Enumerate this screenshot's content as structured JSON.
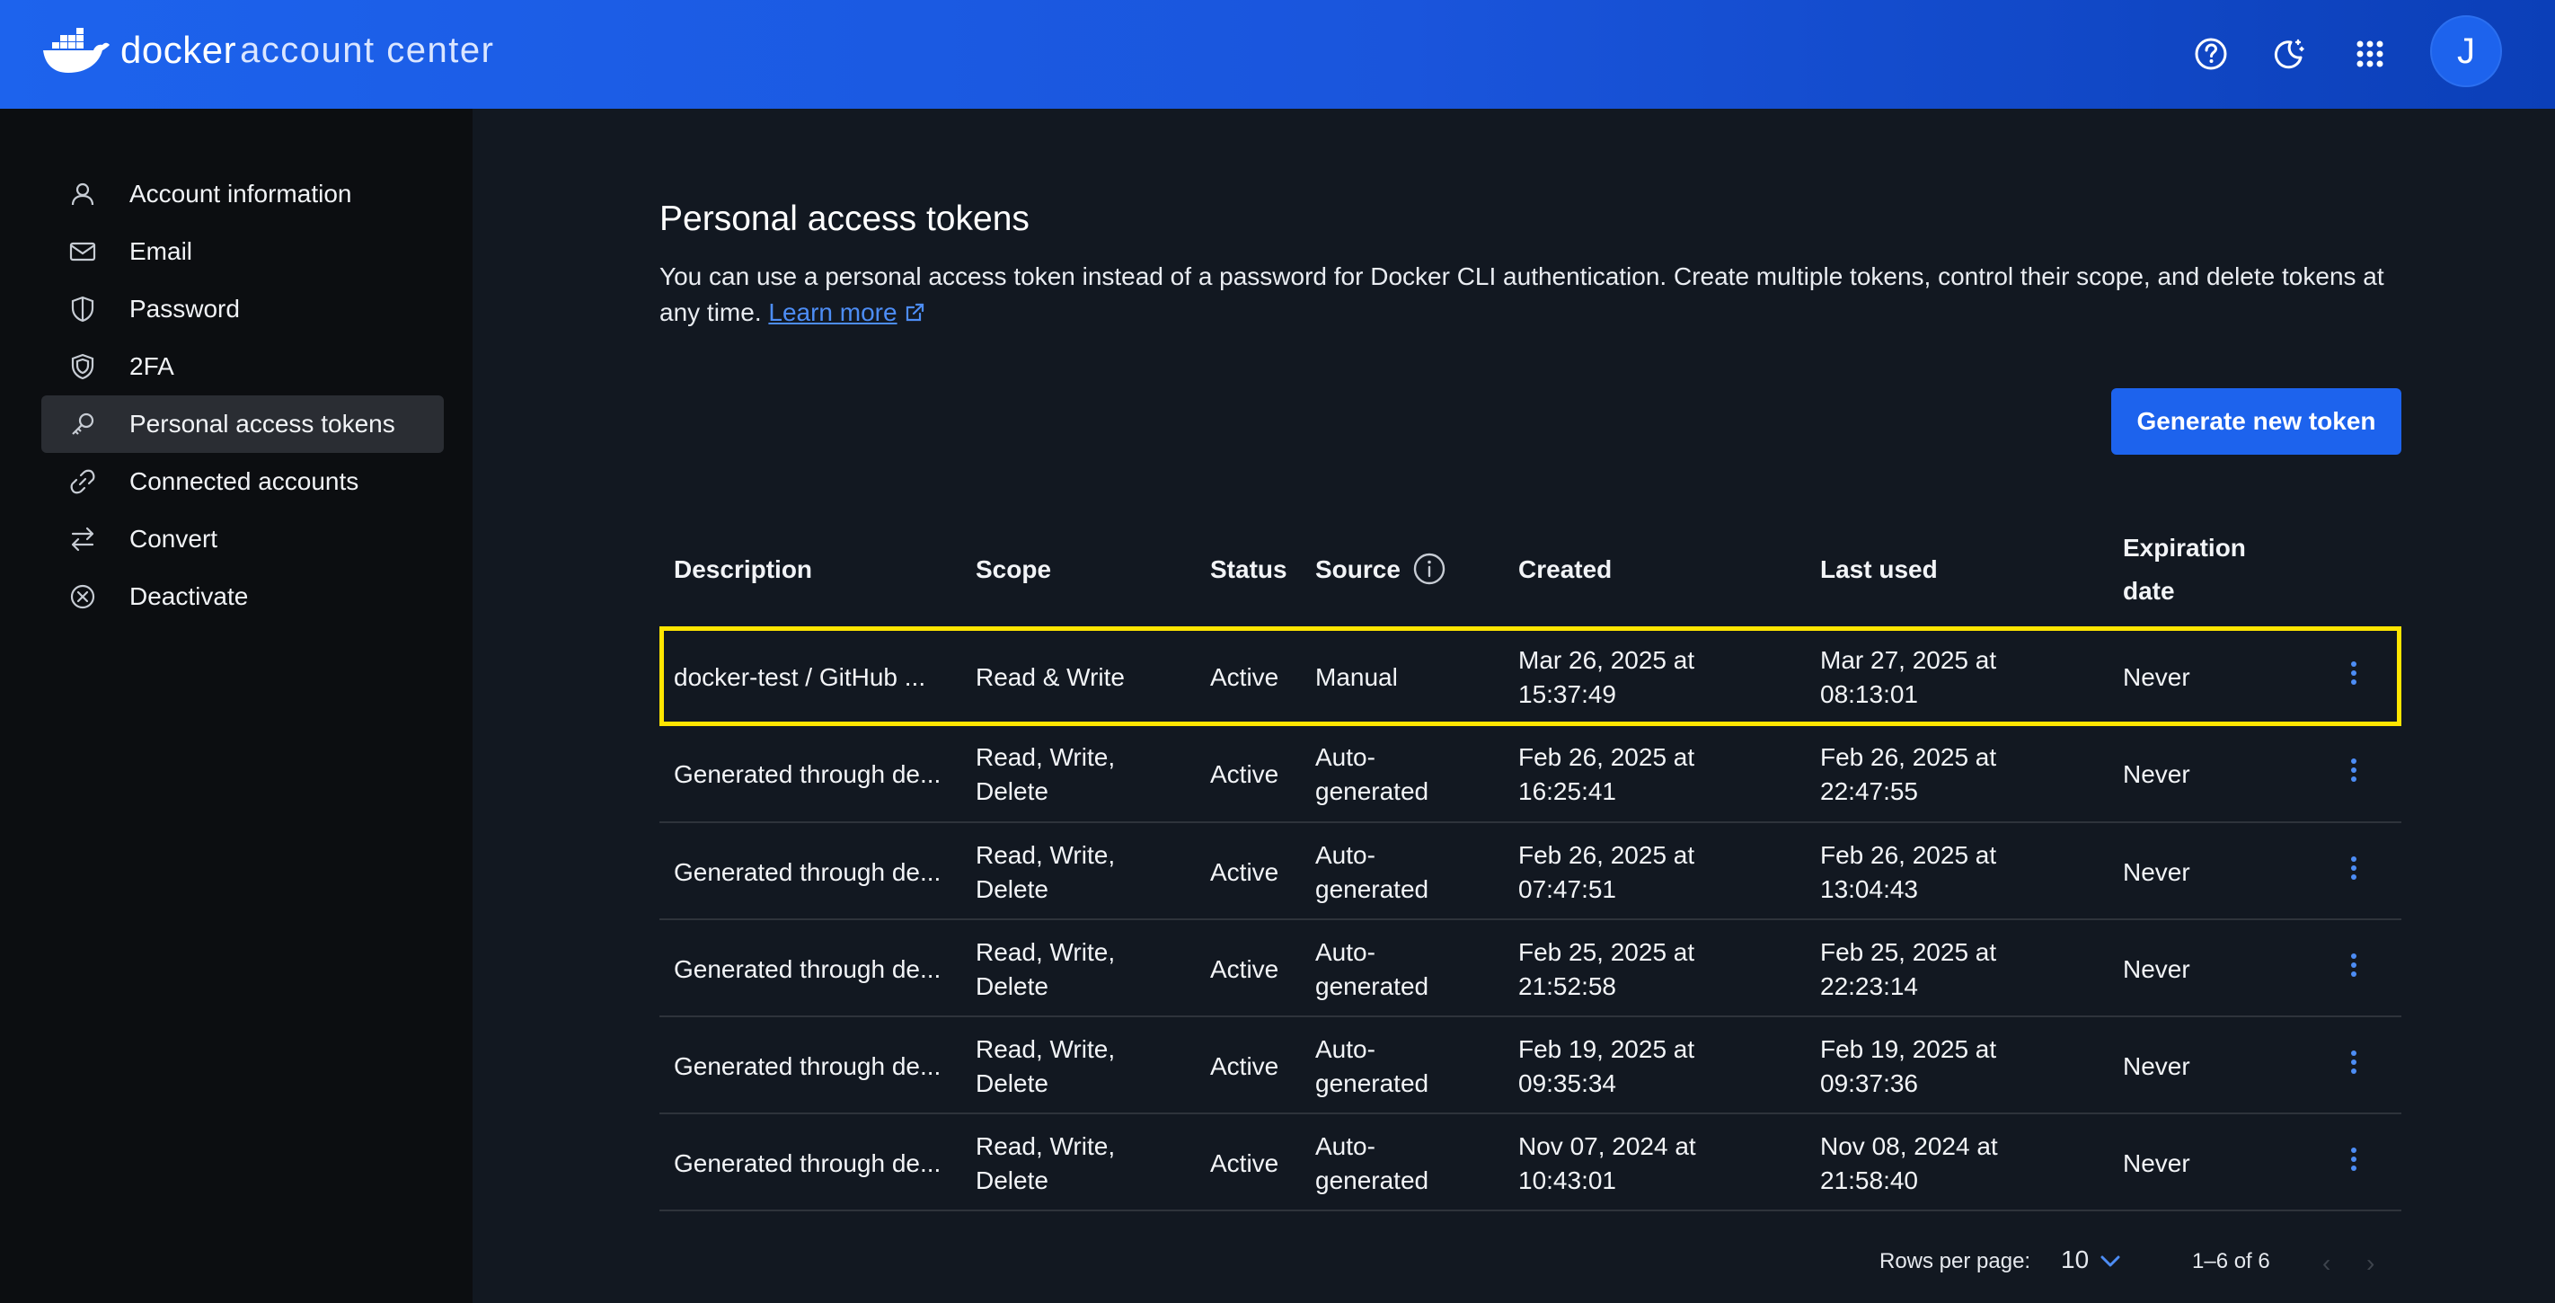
{
  "header": {
    "brand_docker": "docker",
    "brand_sub": "account center",
    "avatar_initial": "J",
    "icons": [
      "help-icon",
      "theme-toggle-icon",
      "apps-grid-icon"
    ]
  },
  "sidebar": {
    "items": [
      {
        "label": "Account information",
        "icon": "user-icon"
      },
      {
        "label": "Email",
        "icon": "mail-icon"
      },
      {
        "label": "Password",
        "icon": "shield-icon"
      },
      {
        "label": "2FA",
        "icon": "shield-double-icon"
      },
      {
        "label": "Personal access tokens",
        "icon": "key-icon",
        "active": true
      },
      {
        "label": "Connected accounts",
        "icon": "link-icon"
      },
      {
        "label": "Convert",
        "icon": "arrows-swap-icon"
      },
      {
        "label": "Deactivate",
        "icon": "x-circle-icon"
      }
    ]
  },
  "main": {
    "title": "Personal access tokens",
    "description": "You can use a personal access token instead of a password for Docker CLI authentication. Create multiple tokens, control their scope, and delete tokens at any time.",
    "learn_more": "Learn more",
    "generate_button": "Generate new token"
  },
  "table": {
    "headers": {
      "description": "Description",
      "scope": "Scope",
      "status": "Status",
      "source": "Source",
      "created": "Created",
      "last_used": "Last used",
      "expiration_1": "Expiration",
      "expiration_2": "date"
    },
    "rows": [
      {
        "description": "docker-test / GitHub ...",
        "scope_1": "Read & Write",
        "scope_2": "",
        "status": "Active",
        "source_1": "Manual",
        "source_2": "",
        "created_1": "Mar 26, 2025 at",
        "created_2": "15:37:49",
        "last_1": "Mar 27, 2025 at",
        "last_2": "08:13:01",
        "expiration": "Never"
      },
      {
        "description": "Generated through de...",
        "scope_1": "Read, Write,",
        "scope_2": "Delete",
        "status": "Active",
        "source_1": "Auto-",
        "source_2": "generated",
        "created_1": "Feb 26, 2025 at",
        "created_2": "16:25:41",
        "last_1": "Feb 26, 2025 at",
        "last_2": "22:47:55",
        "expiration": "Never"
      },
      {
        "description": "Generated through de...",
        "scope_1": "Read, Write,",
        "scope_2": "Delete",
        "status": "Active",
        "source_1": "Auto-",
        "source_2": "generated",
        "created_1": "Feb 26, 2025 at",
        "created_2": "07:47:51",
        "last_1": "Feb 26, 2025 at",
        "last_2": "13:04:43",
        "expiration": "Never"
      },
      {
        "description": "Generated through de...",
        "scope_1": "Read, Write,",
        "scope_2": "Delete",
        "status": "Active",
        "source_1": "Auto-",
        "source_2": "generated",
        "created_1": "Feb 25, 2025 at",
        "created_2": "21:52:58",
        "last_1": "Feb 25, 2025 at",
        "last_2": "22:23:14",
        "expiration": "Never"
      },
      {
        "description": "Generated through de...",
        "scope_1": "Read, Write,",
        "scope_2": "Delete",
        "status": "Active",
        "source_1": "Auto-",
        "source_2": "generated",
        "created_1": "Feb 19, 2025 at",
        "created_2": "09:35:34",
        "last_1": "Feb 19, 2025 at",
        "last_2": "09:37:36",
        "expiration": "Never"
      },
      {
        "description": "Generated through de...",
        "scope_1": "Read, Write,",
        "scope_2": "Delete",
        "status": "Active",
        "source_1": "Auto-",
        "source_2": "generated",
        "created_1": "Nov 07, 2024 at",
        "created_2": "10:43:01",
        "last_1": "Nov 08, 2024 at",
        "last_2": "21:58:40",
        "expiration": "Never"
      }
    ]
  },
  "pagination": {
    "rows_per_page_label": "Rows per page:",
    "rows_per_page_value": "10",
    "range": "1–6 of 6",
    "prev": "‹",
    "next": "›"
  },
  "colors": {
    "brand_blue": "#1d63ed",
    "highlight_border": "#ffe500",
    "link_blue": "#4d8df5"
  }
}
